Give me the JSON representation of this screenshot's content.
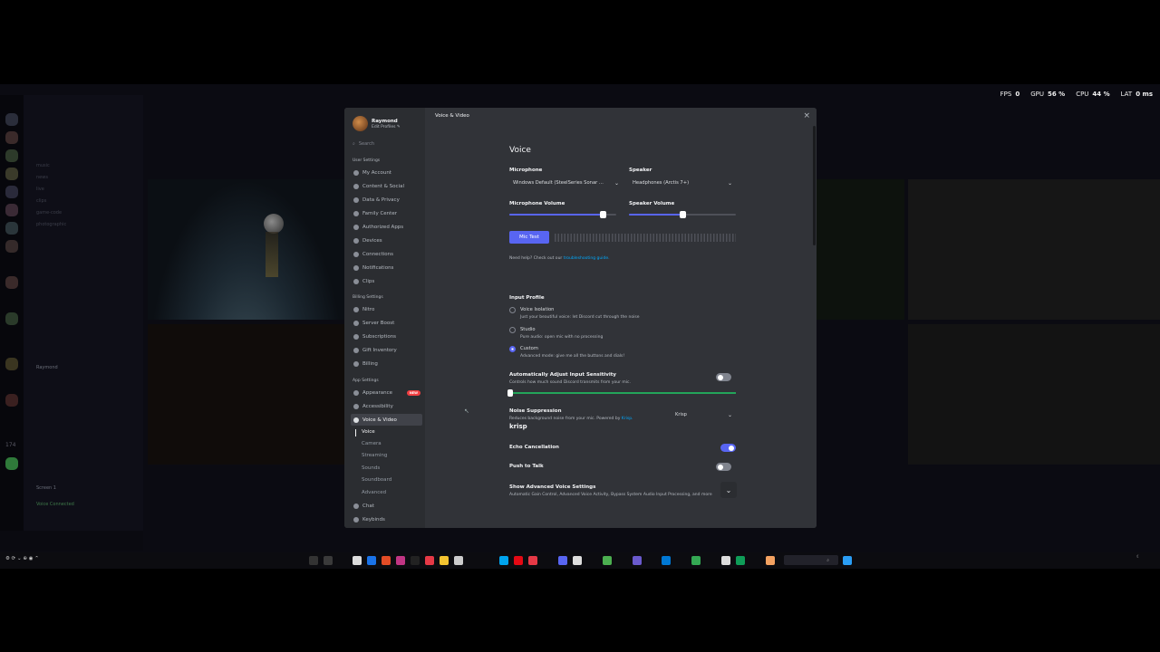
{
  "stats": {
    "fps_label": "FPS",
    "fps": "0",
    "gpu_label": "GPU",
    "gpu": "56 %",
    "cpu_label": "CPU",
    "cpu": "44 %",
    "lat_label": "LAT",
    "lat": "0 ms"
  },
  "profile": {
    "name": "Raymond",
    "edit": "Edit Profiles"
  },
  "search": {
    "placeholder": "Search"
  },
  "sections": {
    "user": "User Settings",
    "billing": "Billing Settings",
    "app": "App Settings"
  },
  "user_items": [
    "My Account",
    "Content & Social",
    "Data & Privacy",
    "Family Center",
    "Authorized Apps",
    "Devices",
    "Connections",
    "Notifications",
    "Clips"
  ],
  "billing_items": [
    "Nitro",
    "Server Boost",
    "Subscriptions",
    "Gift Inventory",
    "Billing"
  ],
  "app_items": {
    "appearance": "Appearance",
    "new_badge": "NEW",
    "accessibility": "Accessibility",
    "voice_video": "Voice & Video",
    "chat": "Chat",
    "keybinds": "Keybinds"
  },
  "voice_sub": [
    "Voice",
    "Camera",
    "Streaming",
    "Sounds",
    "Soundboard",
    "Advanced"
  ],
  "page": {
    "tab_title": "Voice & Video",
    "heading": "Voice",
    "microphone_label": "Microphone",
    "microphone_value": "Windows Default (SteelSeries Sonar ...",
    "speaker_label": "Speaker",
    "speaker_value": "Headphones (Arctis 7+)",
    "mic_volume_label": "Microphone Volume",
    "mic_volume": 0.88,
    "speaker_volume_label": "Speaker Volume",
    "speaker_volume": 0.5,
    "mic_test": "Mic Test",
    "help_prefix": "Need help? Check out our ",
    "help_link": "troubleshooting guide.",
    "input_profile_label": "Input Profile",
    "profiles": [
      {
        "name": "Voice Isolation",
        "desc": "Just your beautiful voice: let Discord cut through the noise",
        "selected": false
      },
      {
        "name": "Studio",
        "desc": "Pure audio: open mic with no processing",
        "selected": false
      },
      {
        "name": "Custom",
        "desc": "Advanced mode: give me all the buttons and dials!",
        "selected": true
      }
    ],
    "auto_sens_label": "Automatically Adjust Input Sensitivity",
    "auto_sens_desc": "Controls how much sound Discord transmits from your mic.",
    "noise_label": "Noise Suppression",
    "noise_desc": "Reduces background noise from your mic. Powered by ",
    "noise_desc_link": "Krisp.",
    "noise_value": "Krisp",
    "krisp_logo": "krisp",
    "echo_label": "Echo Cancellation",
    "echo_on": true,
    "ptt_label": "Push to Talk",
    "advanced_label": "Show Advanced Voice Settings",
    "advanced_desc": "Automatic Gain Control, Advanced Voice Activity, Bypass System Audio Input Processing, and more"
  },
  "bg": {
    "channels": [
      "music",
      "news",
      "live",
      "clips",
      "game-code",
      "photographic"
    ],
    "user_name": "Raymond",
    "screen_label": "Screen 1",
    "voice_connected": "Voice Connected",
    "counter": "174"
  },
  "colors": {
    "blurple": "#5865f2",
    "green": "#23a55a",
    "modal_side": "#2b2d31",
    "modal_content": "#313338"
  }
}
